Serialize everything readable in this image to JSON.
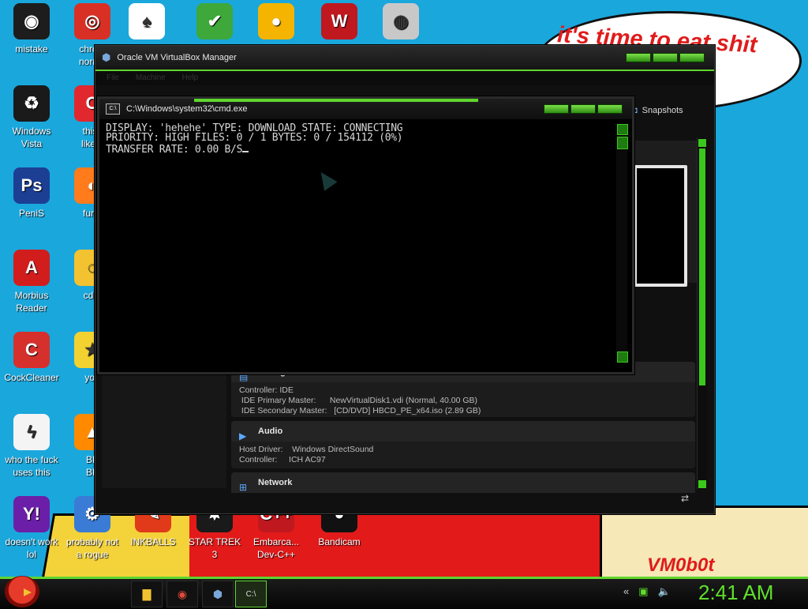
{
  "wallpaper": {
    "speech_bubble_text": "it's time to eat shit\nhew",
    "signature": "VM0b0t"
  },
  "desktop_icons": [
    {
      "name": "mistake",
      "label": "mistake",
      "icon": "green-circle-icon",
      "color": "#1d1d1d"
    },
    {
      "name": "chrome",
      "label": "chrom\nnorma",
      "icon": "chrome-icon",
      "color": "#d93025"
    },
    {
      "name": "solitaire",
      "label": "",
      "icon": "cards-icon",
      "color": "#ffffff"
    },
    {
      "name": "shield",
      "label": "",
      "icon": "shield-check-icon",
      "color": "#3ea83b"
    },
    {
      "name": "bad-piggies",
      "label": "",
      "icon": "pig-icon",
      "color": "#f4b400"
    },
    {
      "name": "logo",
      "label": "",
      "icon": "wings-logo-icon",
      "color": "#c0181f"
    },
    {
      "name": "burn-disc",
      "label": "",
      "icon": "disc-fire-icon",
      "color": "#c8c8c8"
    },
    {
      "name": "windows-vista",
      "label": "Windows\nVista",
      "icon": "recycle-icon",
      "color": "#1a1a1a"
    },
    {
      "name": "this-like",
      "label": "this l\nlike a",
      "icon": "opera-icon",
      "color": "#e0282e"
    },
    {
      "name": "penis",
      "label": "PeniS",
      "icon": "photoshop-icon",
      "color": "#1c3f94"
    },
    {
      "name": "firefox",
      "label": "furry",
      "icon": "firefox-icon",
      "color": "#ff7b1c"
    },
    {
      "name": "morbius-reader",
      "label": "Morbius\nReader",
      "icon": "pdf-icon",
      "color": "#d21d1d"
    },
    {
      "name": "cd",
      "label": "cd d",
      "icon": "cd-icon",
      "color": "#f2c230"
    },
    {
      "name": "cockcleaner",
      "label": "CockCleaner",
      "icon": "ccleaner-icon",
      "color": "#d6302c"
    },
    {
      "name": "you",
      "label": "you",
      "icon": "star-icon",
      "color": "#f2d230"
    },
    {
      "name": "who-the-fuck",
      "label": "who the fuck\nuses this",
      "icon": "lightning-icon",
      "color": "#f4f4f4"
    },
    {
      "name": "vlc",
      "label": "BE\nBE",
      "icon": "cone-icon",
      "color": "#ff8a00"
    },
    {
      "name": "yahoo",
      "label": "doesn't work\nlol",
      "icon": "yahoo-icon",
      "color": "#6b1fa8"
    },
    {
      "name": "probably-not-a-rogue",
      "label": "probably not\na rogue",
      "icon": "monitor-gear-icon",
      "color": "#3a7bd5"
    },
    {
      "name": "inkballs",
      "label": "INKBALLS",
      "icon": "ink-icon",
      "color": "#e03a1a"
    },
    {
      "name": "star-trek",
      "label": "STAR TREK\n3",
      "icon": "star-wars-icon",
      "color": "#1a1a1a"
    },
    {
      "name": "embarcadero",
      "label": "Embarca...\nDev-C++",
      "icon": "devcpp-icon",
      "color": "#c0181f"
    },
    {
      "name": "bandicam",
      "label": "Bandicam",
      "icon": "record-icon",
      "color": "#111111"
    }
  ],
  "vbox": {
    "title": "Oracle VM VirtualBox Manager",
    "menu": "File Machine Help",
    "snapshots_label": "Snapshots",
    "storage": {
      "header": "Storage",
      "rows": [
        "Controller: IDE",
        " IDE Primary Master:      NewVirtualDisk1.vdi (Normal, 40.00 GB)",
        " IDE Secondary Master:   [CD/DVD] HBCD_PE_x64.iso (2.89 GB)"
      ]
    },
    "audio": {
      "header": "Audio",
      "rows": [
        "Host Driver:    Windows DirectSound",
        "Controller:     ICH AC97"
      ]
    },
    "network": {
      "header": "Network"
    }
  },
  "cmd": {
    "title": "C:\\Windows\\system32\\cmd.exe",
    "line1": "DISPLAY: 'hehehe' TYPE: DOWNLOAD STATE: CONNECTING",
    "line2": "PRIORITY: HIGH FILES: 0 / 1 BYTES: 0 / 154112 (0%)",
    "line3": "TRANSFER RATE: 0.00 B/S"
  },
  "taskbar": {
    "start_icon": "angry-bird-icon",
    "buttons": [
      {
        "name": "explorer",
        "icon": "folder-icon",
        "glyph": "▇"
      },
      {
        "name": "chrome",
        "icon": "chrome-icon",
        "glyph": "◉"
      },
      {
        "name": "virtualbox",
        "icon": "virtualbox-icon",
        "glyph": "⬢"
      },
      {
        "name": "cmd",
        "icon": "cmd-icon",
        "glyph": "C:\\"
      }
    ],
    "clock": "2:41 AM",
    "accent_color": "#5fd62e"
  }
}
